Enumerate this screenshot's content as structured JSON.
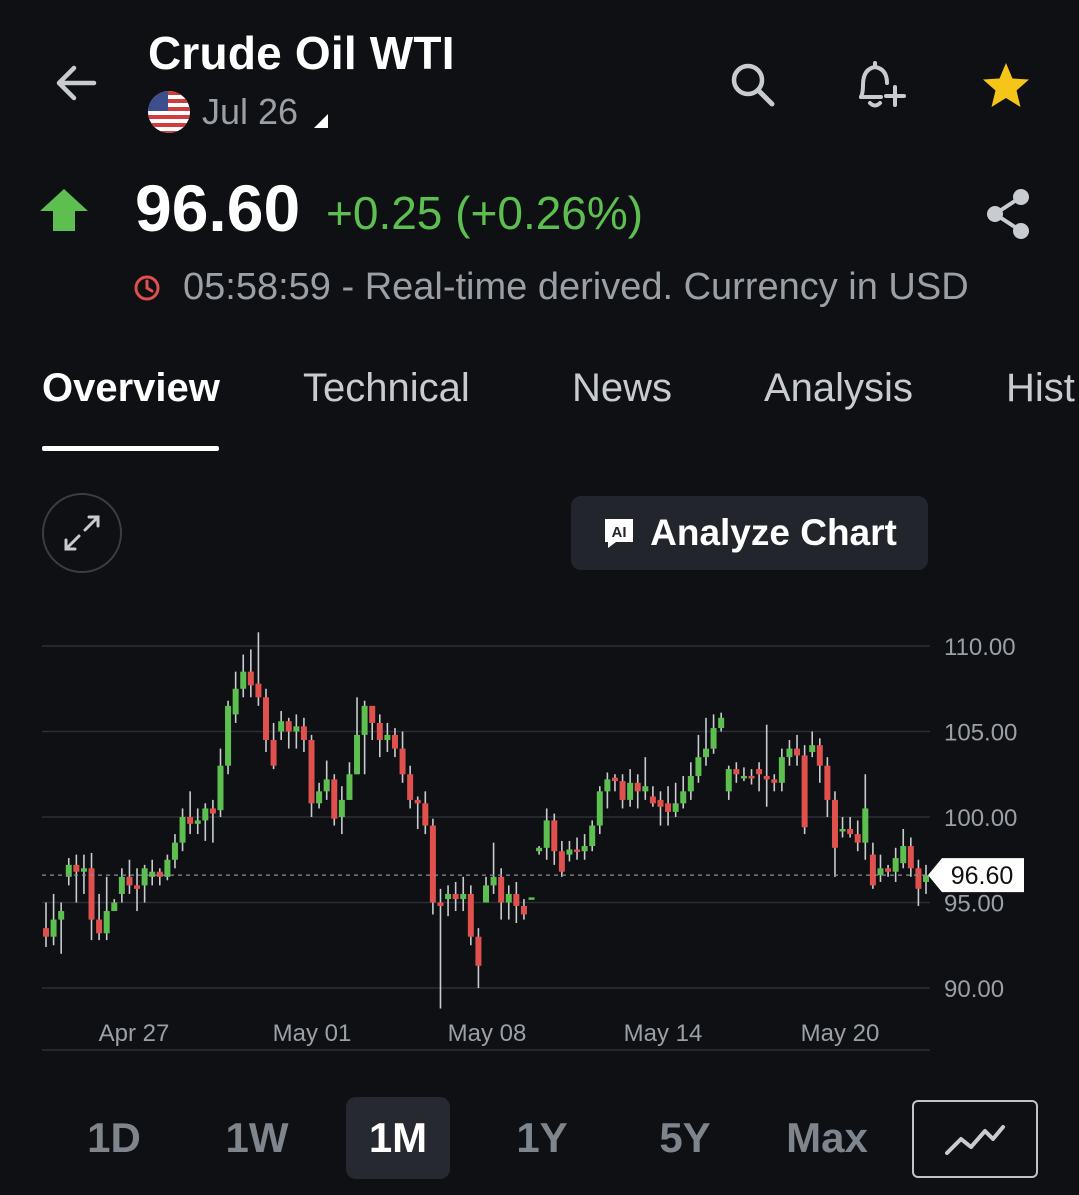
{
  "header": {
    "title": "Crude Oil WTI",
    "contract": "Jul 26",
    "icons": [
      "back-arrow-icon",
      "search-icon",
      "bell-plus-icon",
      "star-icon",
      "us-flag-icon",
      "caret-down-icon"
    ]
  },
  "quote": {
    "price": "96.60",
    "change": "+0.25 (+0.26%)",
    "direction": "up",
    "status": "05:58:59 - Real-time derived. Currency in USD",
    "colors": {
      "up": "#5cbf4f",
      "down": "#e0504d",
      "star": "#f5c518",
      "clock": "#e0504d"
    }
  },
  "tabs": [
    {
      "label": "Overview",
      "active": true
    },
    {
      "label": "Technical",
      "active": false
    },
    {
      "label": "News",
      "active": false
    },
    {
      "label": "Analysis",
      "active": false
    },
    {
      "label": "Hist",
      "active": false
    }
  ],
  "chart_controls": {
    "analyze_label": "Analyze Chart",
    "ai_badge": "AI"
  },
  "chart_data": {
    "type": "candlestick",
    "ylim": [
      88,
      111
    ],
    "yticks": [
      "110.00",
      "105.00",
      "100.00",
      "95.00",
      "90.00"
    ],
    "ytick_values": [
      110,
      105,
      100,
      95,
      90
    ],
    "xticks": [
      "Apr 27",
      "May 01",
      "May 08",
      "May 14",
      "May 20"
    ],
    "current_price_label": "96.60",
    "current_price": 96.6,
    "grid": true,
    "candles": [
      [
        93.5,
        93.0,
        95.0,
        92.4
      ],
      [
        93.0,
        94.0,
        95.5,
        92.5
      ],
      [
        94.0,
        94.5,
        95.0,
        92.0
      ],
      [
        96.5,
        97.2,
        97.6,
        96.0
      ],
      [
        97.2,
        96.8,
        97.8,
        95.0
      ],
      [
        96.8,
        97.0,
        97.8,
        95.5
      ],
      [
        97.0,
        94.0,
        97.9,
        92.8
      ],
      [
        94.0,
        93.2,
        95.5,
        92.8
      ],
      [
        93.2,
        94.5,
        96.5,
        92.8
      ],
      [
        94.5,
        95.0,
        95.2,
        94.8
      ],
      [
        95.5,
        96.5,
        97.0,
        95.0
      ],
      [
        96.5,
        96.0,
        97.5,
        95.5
      ],
      [
        96.0,
        95.8,
        97.0,
        94.5
      ],
      [
        96.0,
        97.0,
        97.2,
        95.0
      ],
      [
        96.5,
        96.8,
        97.5,
        96.0
      ],
      [
        96.8,
        96.5,
        97.0,
        96.0
      ],
      [
        96.5,
        97.5,
        97.8,
        96.3
      ],
      [
        97.5,
        98.5,
        99.0,
        97.0
      ],
      [
        98.5,
        100.0,
        100.5,
        98.0
      ],
      [
        100.0,
        99.6,
        101.5,
        99.0
      ],
      [
        99.6,
        99.8,
        100.5,
        99.0
      ],
      [
        99.8,
        100.5,
        100.8,
        98.6
      ],
      [
        100.5,
        100.2,
        101.0,
        98.5
      ],
      [
        100.4,
        103.0,
        104.0,
        100.0
      ],
      [
        103.0,
        106.5,
        106.8,
        102.5
      ],
      [
        106.0,
        107.5,
        108.5,
        105.5
      ],
      [
        107.5,
        108.5,
        109.5,
        107.0
      ],
      [
        108.5,
        107.7,
        109.8,
        107.0
      ],
      [
        107.8,
        107.0,
        110.8,
        106.5
      ],
      [
        107.0,
        104.5,
        107.5,
        103.8
      ],
      [
        104.5,
        103.0,
        105.5,
        102.8
      ],
      [
        105.0,
        105.6,
        106.2,
        104.5
      ],
      [
        105.6,
        105.0,
        105.8,
        104.0
      ],
      [
        105.0,
        105.3,
        106.0,
        104.0
      ],
      [
        105.3,
        104.5,
        105.8,
        103.8
      ],
      [
        104.5,
        100.8,
        104.8,
        100.0
      ],
      [
        100.8,
        101.5,
        102.0,
        100.5
      ],
      [
        101.5,
        102.2,
        103.3,
        101.0
      ],
      [
        102.2,
        99.9,
        102.5,
        99.5
      ],
      [
        100.0,
        101.0,
        101.8,
        99.0
      ],
      [
        101.0,
        102.5,
        103.2,
        101.0
      ],
      [
        102.5,
        104.8,
        107.0,
        102.5
      ],
      [
        104.8,
        106.5,
        106.8,
        102.5
      ],
      [
        106.5,
        105.5,
        106.2,
        104.5
      ],
      [
        105.5,
        104.5,
        106.0,
        103.5
      ],
      [
        104.5,
        104.8,
        105.5,
        103.8
      ],
      [
        104.8,
        104.0,
        105.2,
        103.5
      ],
      [
        104.0,
        102.5,
        105.0,
        102.0
      ],
      [
        102.5,
        101.0,
        103.0,
        100.5
      ],
      [
        101.0,
        100.8,
        101.2,
        99.3
      ],
      [
        100.8,
        99.5,
        101.5,
        99.0
      ],
      [
        99.5,
        95.0,
        99.9,
        94.3
      ],
      [
        95.0,
        94.8,
        95.8,
        88.8
      ],
      [
        95.2,
        95.5,
        96.0,
        94.2
      ],
      [
        95.5,
        95.2,
        96.2,
        94.5
      ],
      [
        95.2,
        95.5,
        96.5,
        94.5
      ],
      [
        95.5,
        93.0,
        96.0,
        92.5
      ],
      [
        93.0,
        91.3,
        93.5,
        90.0
      ],
      [
        95.0,
        96.0,
        96.5,
        95.0
      ],
      [
        96.0,
        96.5,
        98.5,
        95.5
      ],
      [
        96.5,
        95.0,
        97.0,
        94.0
      ],
      [
        95.0,
        95.5,
        96.0,
        94.0
      ],
      [
        95.5,
        94.8,
        96.2,
        93.8
      ],
      [
        94.8,
        94.3,
        95.2,
        94.0
      ],
      [
        95.2,
        95.3,
        95.3,
        95.3
      ],
      [
        98.0,
        98.2,
        98.3,
        97.8
      ],
      [
        98.2,
        99.8,
        100.5,
        97.5
      ],
      [
        99.8,
        98.0,
        100.2,
        97.2
      ],
      [
        98.0,
        96.8,
        98.6,
        96.5
      ],
      [
        97.8,
        98.1,
        98.6,
        97.4
      ],
      [
        98.1,
        98.0,
        98.8,
        97.5
      ],
      [
        98.0,
        98.3,
        99.0,
        97.5
      ],
      [
        98.3,
        99.5,
        99.8,
        98.0
      ],
      [
        99.5,
        101.5,
        101.8,
        99.0
      ],
      [
        101.5,
        102.2,
        102.6,
        100.5
      ],
      [
        102.3,
        102.1,
        102.5,
        101.5
      ],
      [
        102.1,
        101.0,
        102.5,
        100.5
      ],
      [
        101.0,
        102.0,
        102.8,
        100.6
      ],
      [
        102.0,
        101.5,
        102.5,
        100.5
      ],
      [
        101.5,
        101.8,
        103.5,
        101.0
      ],
      [
        101.2,
        100.8,
        101.8,
        100.6
      ],
      [
        101.0,
        100.6,
        101.5,
        99.5
      ],
      [
        100.8,
        100.3,
        101.8,
        99.5
      ],
      [
        100.3,
        100.8,
        102.0,
        100.0
      ],
      [
        100.8,
        101.5,
        102.4,
        100.5
      ],
      [
        101.5,
        102.4,
        103.2,
        101.0
      ],
      [
        102.4,
        103.5,
        104.8,
        102.0
      ],
      [
        103.5,
        104.0,
        105.8,
        103.0
      ],
      [
        104.0,
        105.2,
        106.0,
        103.7
      ],
      [
        105.2,
        105.8,
        106.1,
        105.0
      ],
      [
        101.5,
        102.8,
        103.0,
        101.0
      ],
      [
        102.8,
        102.5,
        103.2,
        102.0
      ],
      [
        102.4,
        102.4,
        102.9,
        102.1
      ],
      [
        102.4,
        102.3,
        102.8,
        101.9
      ],
      [
        102.8,
        102.5,
        103.2,
        101.5
      ],
      [
        102.4,
        102.2,
        105.4,
        100.6
      ],
      [
        102.2,
        102.0,
        102.5,
        101.5
      ],
      [
        102.0,
        103.5,
        104.0,
        101.5
      ],
      [
        103.5,
        104.0,
        104.5,
        103.0
      ],
      [
        104.0,
        103.6,
        104.8,
        103.0
      ],
      [
        103.6,
        99.4,
        104.2,
        99.0
      ],
      [
        103.8,
        104.2,
        105.0,
        103.5
      ],
      [
        104.2,
        103.0,
        104.6,
        102.0
      ],
      [
        103.0,
        101.0,
        103.5,
        100.0
      ],
      [
        101.0,
        98.2,
        101.5,
        96.5
      ],
      [
        99.2,
        99.3,
        100.0,
        98.8
      ],
      [
        99.3,
        99.0,
        100.0,
        98.8
      ],
      [
        99.0,
        98.5,
        99.8,
        98.0
      ],
      [
        98.5,
        100.5,
        102.5,
        97.5
      ],
      [
        97.8,
        96.0,
        98.5,
        95.8
      ],
      [
        96.6,
        97.0,
        97.8,
        96.2
      ],
      [
        97.0,
        96.8,
        97.2,
        96.5
      ],
      [
        96.8,
        97.6,
        98.2,
        96.2
      ],
      [
        97.3,
        98.3,
        99.3,
        97.0
      ],
      [
        98.3,
        97.0,
        98.8,
        96.5
      ],
      [
        97.0,
        95.8,
        97.5,
        94.8
      ],
      [
        96.2,
        96.6,
        97.2,
        95.5
      ]
    ]
  }
}
